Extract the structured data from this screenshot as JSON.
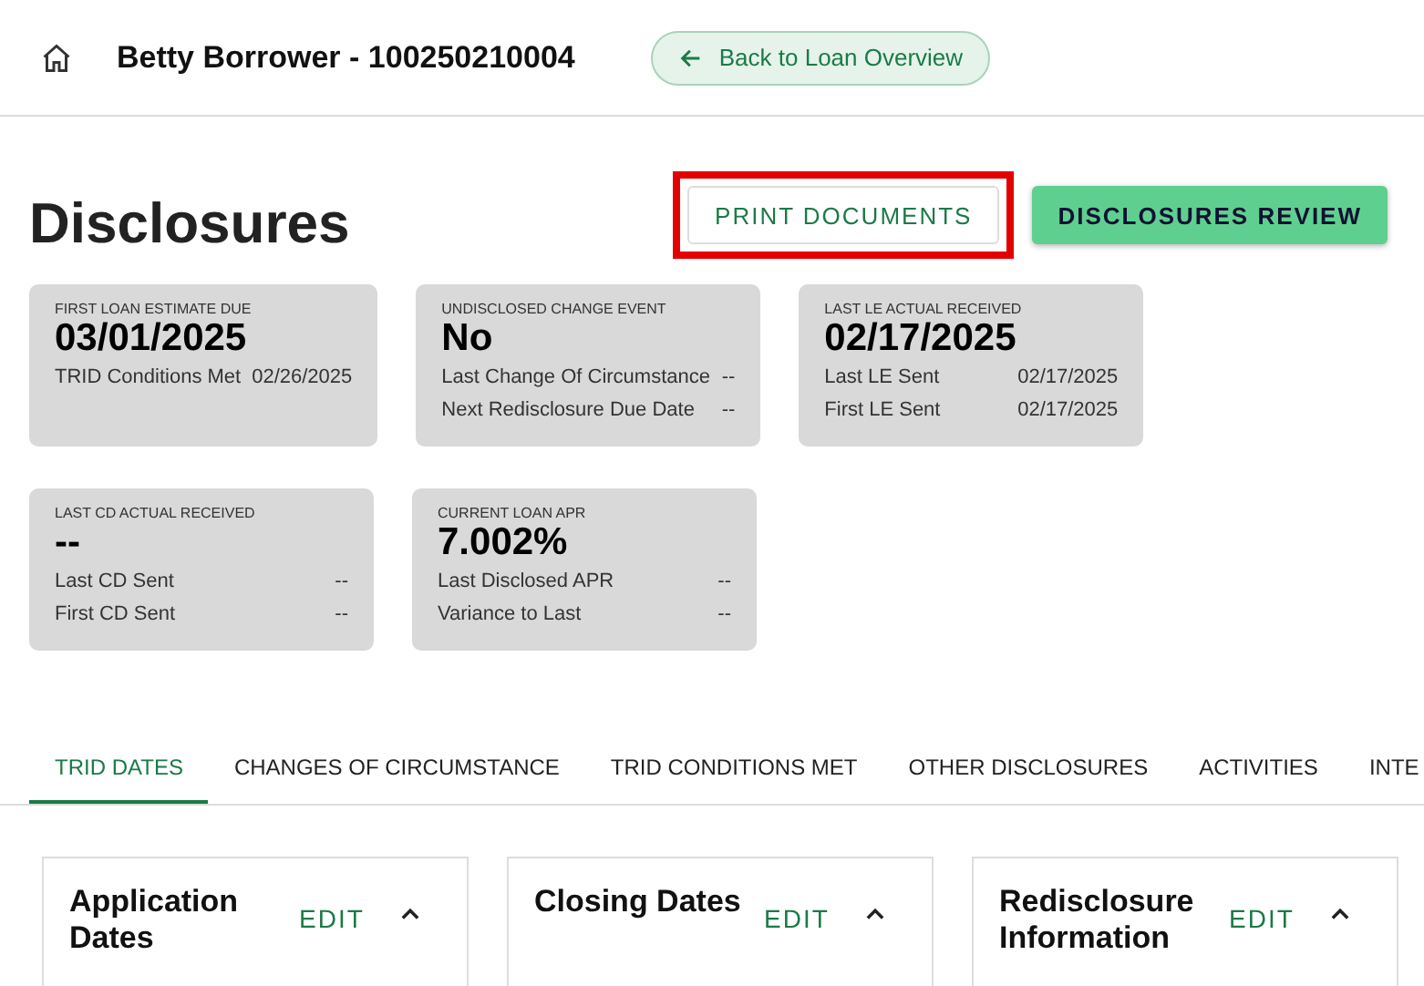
{
  "header": {
    "title": "Betty Borrower - 100250210004",
    "back_button": "Back to Loan Overview"
  },
  "page": {
    "title": "Disclosures",
    "buttons": [
      {
        "label": "PRINT DOCUMENTS",
        "kind": "outlined",
        "highlighted": true
      },
      {
        "label": "DISCLOSURES REVIEW",
        "kind": "filled",
        "highlighted": false
      }
    ]
  },
  "summary_rows": [
    [
      {
        "label": "FIRST LOAN ESTIMATE DUE",
        "value": "03/01/2025",
        "details": [
          {
            "name": "TRID Conditions Met",
            "value": "02/26/2025"
          }
        ]
      },
      {
        "label": "UNDISCLOSED CHANGE EVENT",
        "value": "No",
        "details": [
          {
            "name": "Last Change Of Circumstance",
            "value": "--"
          },
          {
            "name": "Next Redisclosure Due Date",
            "value": "--"
          }
        ]
      },
      {
        "label": "LAST LE ACTUAL RECEIVED",
        "value": "02/17/2025",
        "details": [
          {
            "name": "Last LE Sent",
            "value": "02/17/2025"
          },
          {
            "name": "First LE Sent",
            "value": "02/17/2025"
          }
        ]
      }
    ],
    [
      {
        "label": "LAST CD ACTUAL RECEIVED",
        "value": "--",
        "details": [
          {
            "name": "Last CD Sent",
            "value": "--"
          },
          {
            "name": "First CD Sent",
            "value": "--"
          }
        ]
      },
      {
        "label": "CURRENT LOAN APR",
        "value": "7.002%",
        "details": [
          {
            "name": "Last Disclosed APR",
            "value": "--"
          },
          {
            "name": "Variance to Last",
            "value": "--"
          }
        ]
      }
    ]
  ],
  "tabs": [
    {
      "label": "TRID DATES",
      "selected": true
    },
    {
      "label": "CHANGES OF CIRCUMSTANCE",
      "selected": false
    },
    {
      "label": "TRID CONDITIONS MET",
      "selected": false
    },
    {
      "label": "OTHER DISCLOSURES",
      "selected": false
    },
    {
      "label": "ACTIVITIES",
      "selected": false
    },
    {
      "label": "INTE",
      "selected": false
    }
  ],
  "panels": [
    {
      "title": "Application Dates",
      "action": "EDIT",
      "expanded": true
    },
    {
      "title": "Closing Dates",
      "action": "EDIT",
      "expanded": true
    },
    {
      "title": "Redisclosure Information",
      "action": "EDIT",
      "expanded": true
    }
  ]
}
